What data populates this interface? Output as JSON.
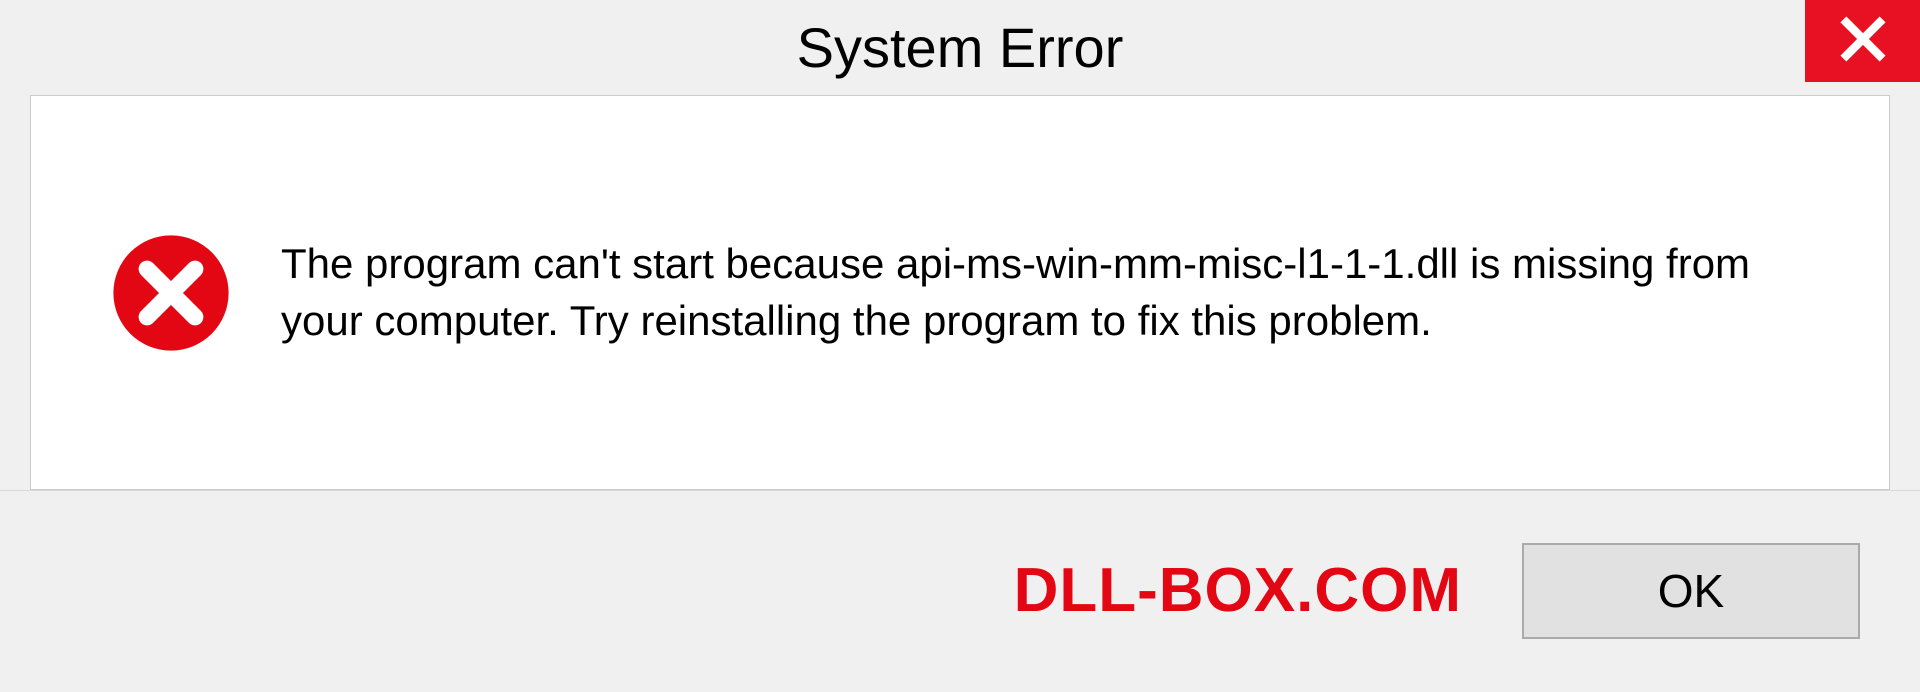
{
  "dialog": {
    "title": "System Error",
    "message": "The program can't start because api-ms-win-mm-misc-l1-1-1.dll is missing from your computer. Try reinstalling the program to fix this problem.",
    "ok_label": "OK"
  },
  "watermark": {
    "text": "DLL-BOX.COM"
  },
  "colors": {
    "close_button": "#e81123",
    "error_icon": "#e30613",
    "watermark": "#e30613"
  }
}
